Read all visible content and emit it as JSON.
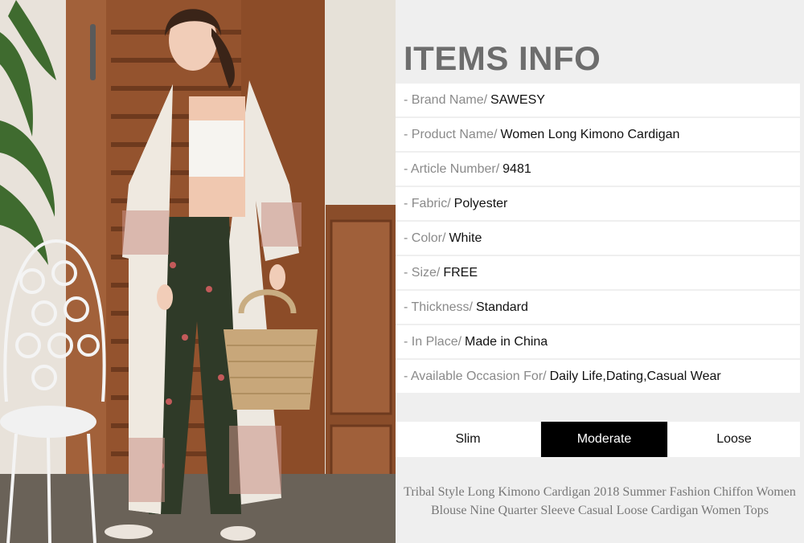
{
  "items_info": {
    "title": "ITEMS INFO",
    "rows": [
      {
        "label": "- Brand Name/",
        "value": "SAWESY"
      },
      {
        "label": "- Product Name/",
        "value": "Women Long Kimono Cardigan"
      },
      {
        "label": "- Article Number/",
        "value": "9481"
      },
      {
        "label": "- Fabric/",
        "value": "Polyester"
      },
      {
        "label": "- Color/",
        "value": "White"
      },
      {
        "label": "- Size/",
        "value": "FREE"
      },
      {
        "label": "- Thickness/",
        "value": "Standard"
      },
      {
        "label": "- In Place/",
        "value": "Made in China"
      },
      {
        "label": "- Available Occasion For/",
        "value": "Daily Life,Dating,Casual Wear"
      }
    ]
  },
  "fit_options": {
    "options": [
      "Slim",
      "Moderate",
      "Loose"
    ],
    "selected": "Moderate"
  },
  "description": "Tribal Style Long Kimono Cardigan 2018  Summer Fashion Chiffon Women Blouse Nine Quarter Sleeve Casual Loose Cardigan Women Tops",
  "colors": {
    "panel_bg": "#efefef",
    "row_bg": "#ffffff",
    "title": "#6d6d6d",
    "label": "#8a8a8a",
    "value": "#111111",
    "selected_bg": "#000000",
    "description": "#777777"
  }
}
